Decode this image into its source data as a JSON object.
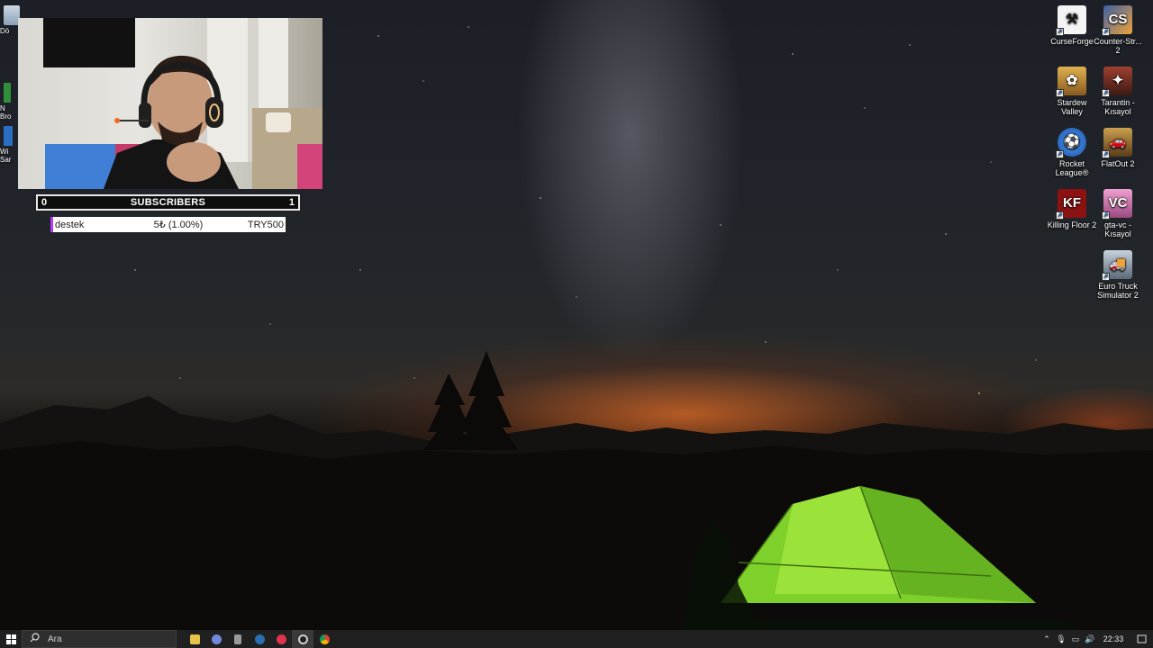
{
  "desktop": {
    "left_icons": [
      {
        "label": "Dö",
        "icon": "recycle-bin-icon"
      },
      {
        "label": "N\nBro",
        "icon": "app-icon"
      },
      {
        "label": "Wi\nSar",
        "icon": "app-icon"
      }
    ],
    "right_icons": [
      {
        "label": "CurseForge",
        "icon": "curseforge-icon",
        "color": "#1a1a1a"
      },
      {
        "label": "Counter-Str...\n2",
        "icon": "counter-strike-icon",
        "color": "#3b5fa6"
      },
      {
        "label": "Stardew\nValley",
        "icon": "stardew-valley-icon",
        "color": "#c98a3a"
      },
      {
        "label": "Tarantin -\nKısayol",
        "icon": "tarantin-icon",
        "color": "#7a2c20"
      },
      {
        "label": "Rocket\nLeague®",
        "icon": "rocket-league-icon",
        "color": "#1f63c9"
      },
      {
        "label": "FlatOut 2",
        "icon": "flatout-icon",
        "color": "#a8782c"
      },
      {
        "label": "Killing Floor 2",
        "icon": "killing-floor-icon",
        "color": "#8c1212"
      },
      {
        "label": "gta-vc -\nKısayol",
        "icon": "gta-vc-icon",
        "color": "#d884b8"
      },
      {
        "label": "Euro Truck\nSimulator 2",
        "icon": "euro-truck-icon",
        "color": "#8a9aa8"
      }
    ]
  },
  "overlay": {
    "subscriber_goal": {
      "min": "0",
      "label": "SUBSCRIBERS",
      "max": "1"
    },
    "donation": {
      "name": "destek",
      "amount": "5₺ (1.00%)",
      "target": "TRY500"
    }
  },
  "taskbar": {
    "search_placeholder": "Ara",
    "apps": [
      {
        "icon": "file-explorer-icon",
        "color": "#e8c34a"
      },
      {
        "icon": "discord-icon",
        "color": "#7289da"
      },
      {
        "icon": "terminal-icon",
        "color": "#9a9a9a"
      },
      {
        "icon": "steam-icon",
        "color": "#2a6fb0"
      },
      {
        "icon": "record-app-icon",
        "color": "#e0344e"
      },
      {
        "icon": "obs-icon",
        "color": "#cfcfcf"
      },
      {
        "icon": "chrome-icon",
        "color": "#e4b022"
      }
    ],
    "clock": "22:33"
  }
}
